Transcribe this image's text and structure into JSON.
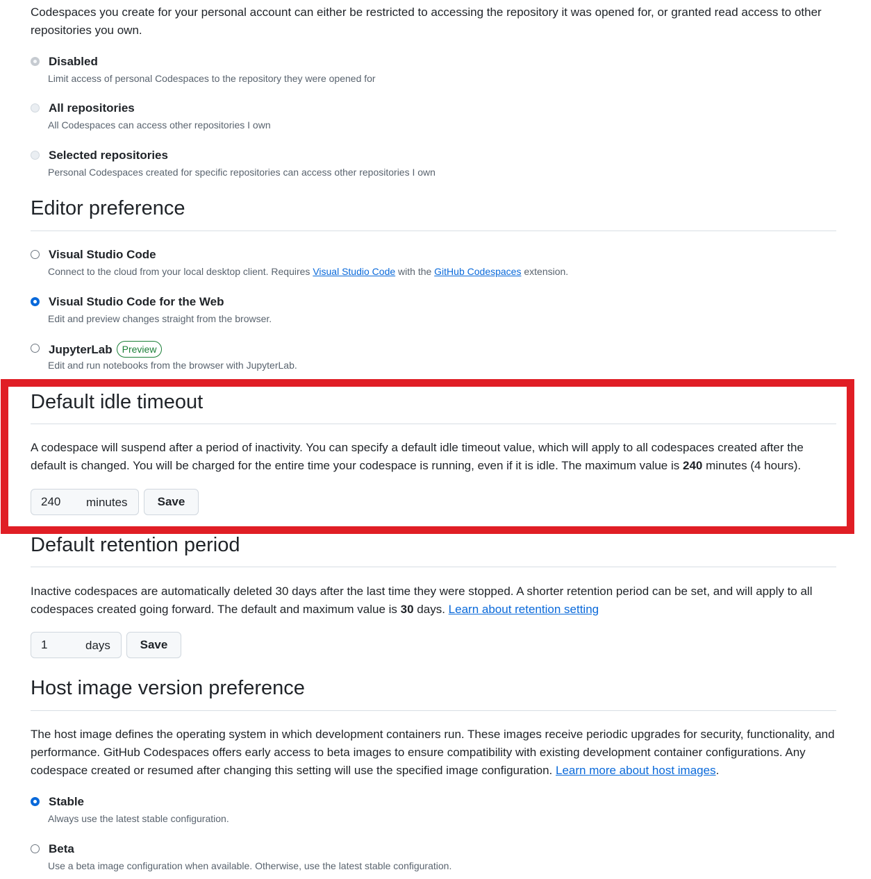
{
  "intro": "Codespaces you create for your personal account can either be restricted to accessing the repository it was opened for, or granted read access to other repositories you own.",
  "access": {
    "options": [
      {
        "label": "Disabled",
        "desc": "Limit access of personal Codespaces to the repository they were opened for"
      },
      {
        "label": "All repositories",
        "desc": "All Codespaces can access other repositories I own"
      },
      {
        "label": "Selected repositories",
        "desc": "Personal Codespaces created for specific repositories can access other repositories I own"
      }
    ],
    "selected": "Disabled"
  },
  "editor": {
    "title": "Editor preference",
    "options": [
      {
        "label": "Visual Studio Code",
        "desc_prefix": "Connect to the cloud from your local desktop client. Requires ",
        "link1": "Visual Studio Code",
        "desc_mid": " with the ",
        "link2": "GitHub Codespaces",
        "desc_suffix": " extension."
      },
      {
        "label": "Visual Studio Code for the Web",
        "desc": "Edit and preview changes straight from the browser."
      },
      {
        "label": "JupyterLab",
        "badge": "Preview",
        "desc": "Edit and run notebooks from the browser with JupyterLab."
      }
    ],
    "selected": "Visual Studio Code for the Web"
  },
  "idle": {
    "title": "Default idle timeout",
    "desc_prefix": "A codespace will suspend after a period of inactivity. You can specify a default idle timeout value, which will apply to all codespaces created after the default is changed. You will be charged for the entire time your codespace is running, even if it is idle. The maximum value is ",
    "desc_bold": "240",
    "desc_suffix": " minutes (4 hours).",
    "value": "240",
    "unit": "minutes",
    "save_label": "Save"
  },
  "retention": {
    "title": "Default retention period",
    "desc_prefix": "Inactive codespaces are automatically deleted 30 days after the last time they were stopped. A shorter retention period can be set, and will apply to all codespaces created going forward. The default and maximum value is ",
    "desc_bold": "30",
    "desc_mid": " days. ",
    "link": "Learn about retention setting",
    "value": "1",
    "unit": "days",
    "save_label": "Save"
  },
  "host": {
    "title": "Host image version preference",
    "desc_prefix": "The host image defines the operating system in which development containers run. These images receive periodic upgrades for security, functionality, and performance. GitHub Codespaces offers early access to beta images to ensure compatibility with existing development container configurations. Any codespace created or resumed after changing this setting will use the specified image configuration. ",
    "link": "Learn more about host images",
    "desc_suffix": ".",
    "options": [
      {
        "label": "Stable",
        "desc": "Always use the latest stable configuration."
      },
      {
        "label": "Beta",
        "desc": "Use a beta image configuration when available. Otherwise, use the latest stable configuration."
      }
    ],
    "selected": "Stable"
  },
  "colors": {
    "highlight": "#e01e25",
    "link": "#0969da",
    "badge": "#1a7f37"
  }
}
